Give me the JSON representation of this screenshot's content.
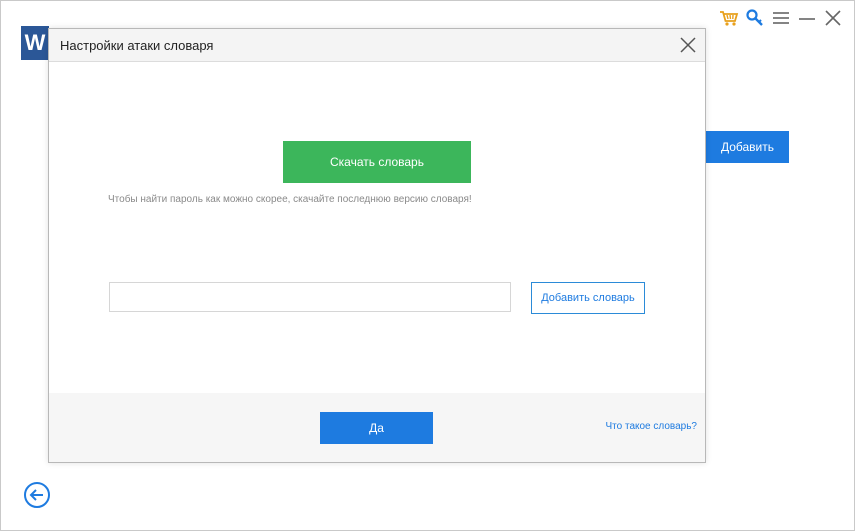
{
  "app": {
    "logo_letter": "W"
  },
  "topbar": {
    "icons": [
      "cart-icon",
      "key-icon",
      "menu-icon",
      "minimize-icon",
      "close-icon"
    ]
  },
  "background": {
    "add_label": "Добавить"
  },
  "dialog": {
    "title": "Настройки атаки словаря",
    "download_label": "Скачать словарь",
    "hint": "Чтобы найти пароль как можно скорее, скачайте последнюю версию словаря!",
    "input_value": "",
    "input_placeholder": "",
    "add_dictionary_label": "Добавить словарь",
    "ok_label": "Да",
    "help_link": "Что такое словарь?"
  },
  "colors": {
    "primary_blue": "#1e7be0",
    "green": "#3cb65b",
    "cart_orange": "#e8a01c",
    "logo_blue": "#2b5797"
  }
}
